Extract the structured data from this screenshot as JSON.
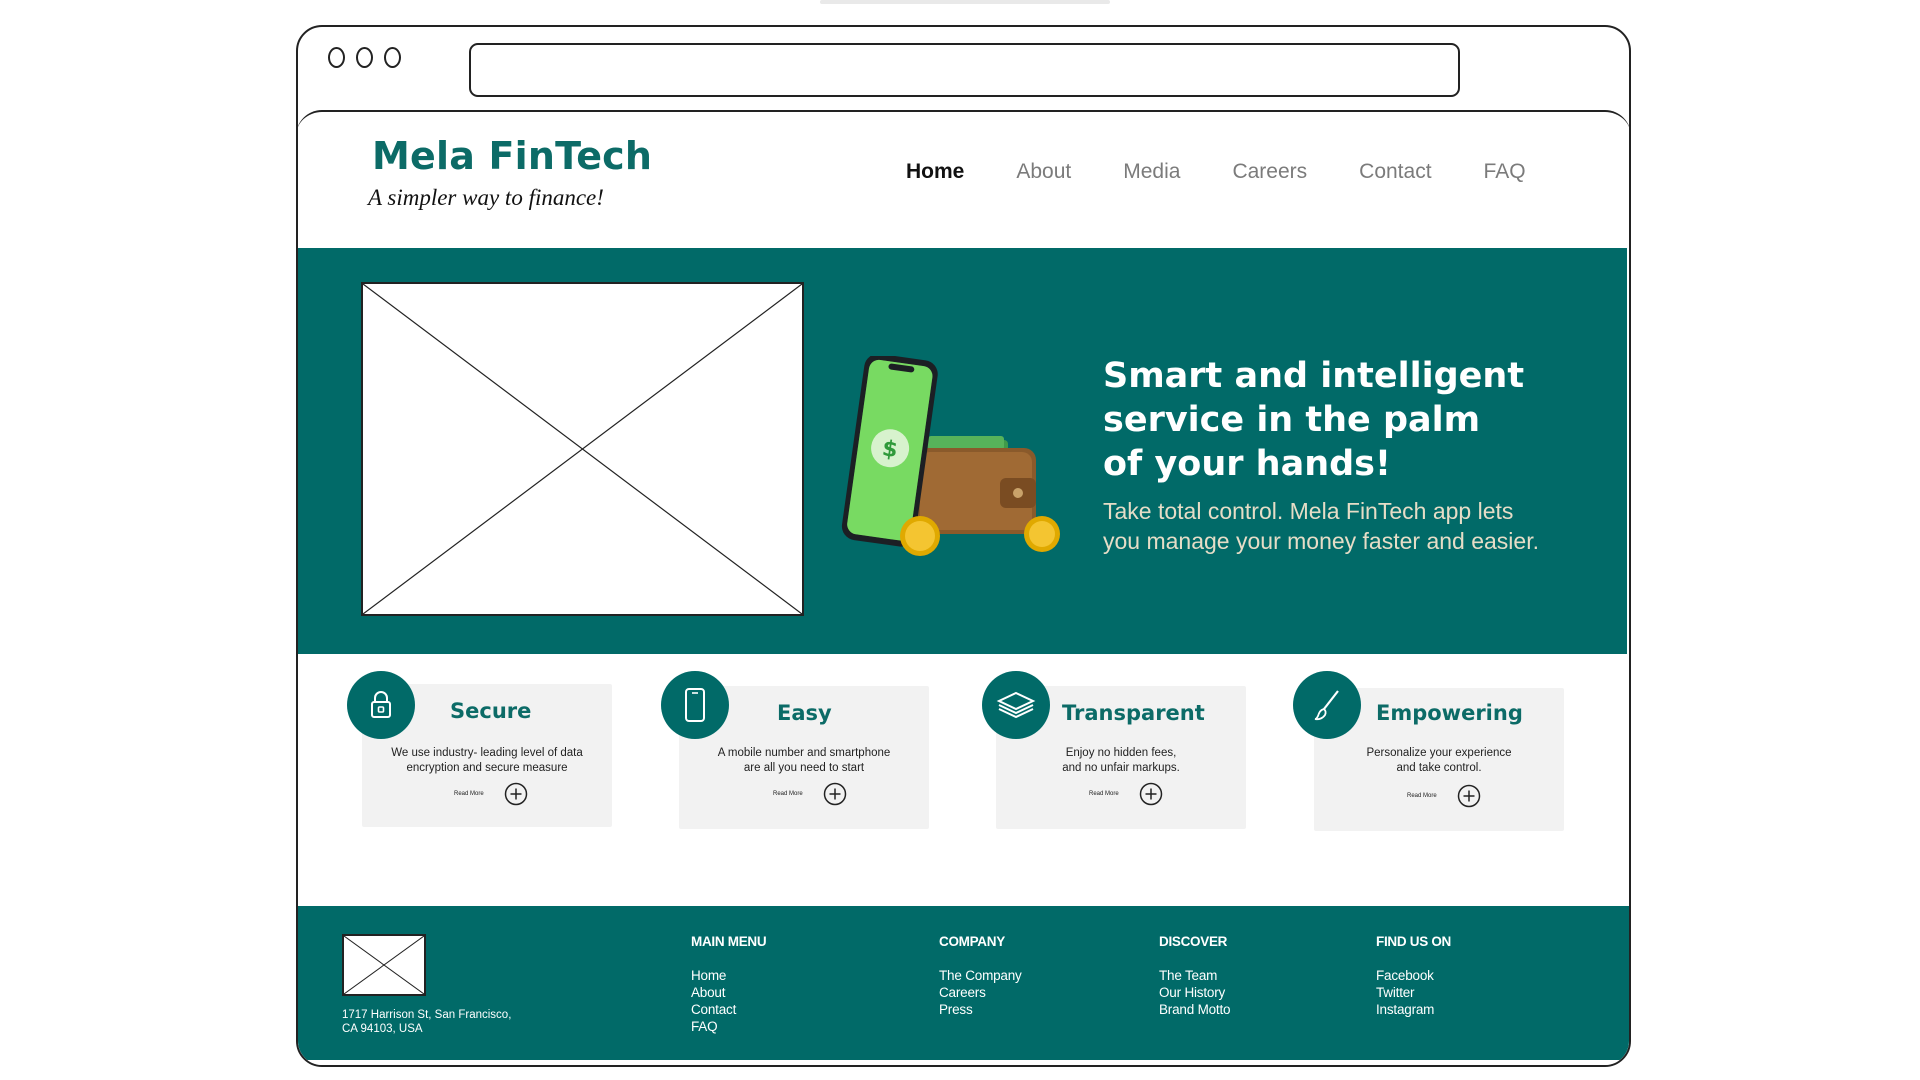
{
  "browser": {
    "window_controls": [
      "circle",
      "circle",
      "circle"
    ],
    "address_value": ""
  },
  "header": {
    "brand": "Mela FinTech",
    "tagline": "A simpler way to finance!",
    "nav": [
      {
        "label": "Home",
        "active": true
      },
      {
        "label": "About",
        "active": false
      },
      {
        "label": "Media",
        "active": false
      },
      {
        "label": "Careers",
        "active": false
      },
      {
        "label": "Contact",
        "active": false
      },
      {
        "label": "FAQ",
        "active": false
      }
    ]
  },
  "hero": {
    "heading_lines": [
      "Smart and intelligent",
      "service in the palm",
      "of your hands!"
    ],
    "subtext_lines": [
      "Take total control. Mela FinTech app lets",
      "you manage your money faster and easier."
    ],
    "illustration_icon": "phone-wallet-illustration",
    "background_color": "#016a68"
  },
  "features": [
    {
      "title": "Secure",
      "icon": "lock-icon",
      "desc_lines": [
        "We use industry- leading level of data",
        "encryption and secure measure"
      ],
      "read_more": "Read More"
    },
    {
      "title": "Easy",
      "icon": "smartphone-icon",
      "desc_lines": [
        "A mobile number and smartphone",
        "are all you need to start"
      ],
      "read_more": "Read More"
    },
    {
      "title": "Transparent",
      "icon": "layers-icon",
      "desc_lines": [
        "Enjoy no hidden fees,",
        "and no unfair markups."
      ],
      "read_more": "Read More"
    },
    {
      "title": "Empowering",
      "icon": "brush-icon",
      "desc_lines": [
        "Personalize your experience",
        "and take control."
      ],
      "read_more": "Read More"
    }
  ],
  "footer": {
    "address_lines": [
      "1717 Harrison St, San Francisco,",
      "CA 94103, USA"
    ],
    "columns": [
      {
        "title": "MAIN MENU",
        "links": [
          "Home",
          "About",
          "Contact",
          "FAQ"
        ]
      },
      {
        "title": "COMPANY",
        "links": [
          "The Company",
          "Careers",
          "Press"
        ]
      },
      {
        "title": "DISCOVER",
        "links": [
          "The Team",
          "Our History",
          "Brand Motto"
        ]
      },
      {
        "title": "FIND US ON",
        "links": [
          "Facebook",
          "Twitter",
          "Instagram"
        ]
      }
    ]
  },
  "colors": {
    "brand_teal": "#016a68",
    "title_teal": "#0c6b67",
    "hero_subtext": "#e6ddc7",
    "card_bg": "#f2f2f2"
  }
}
